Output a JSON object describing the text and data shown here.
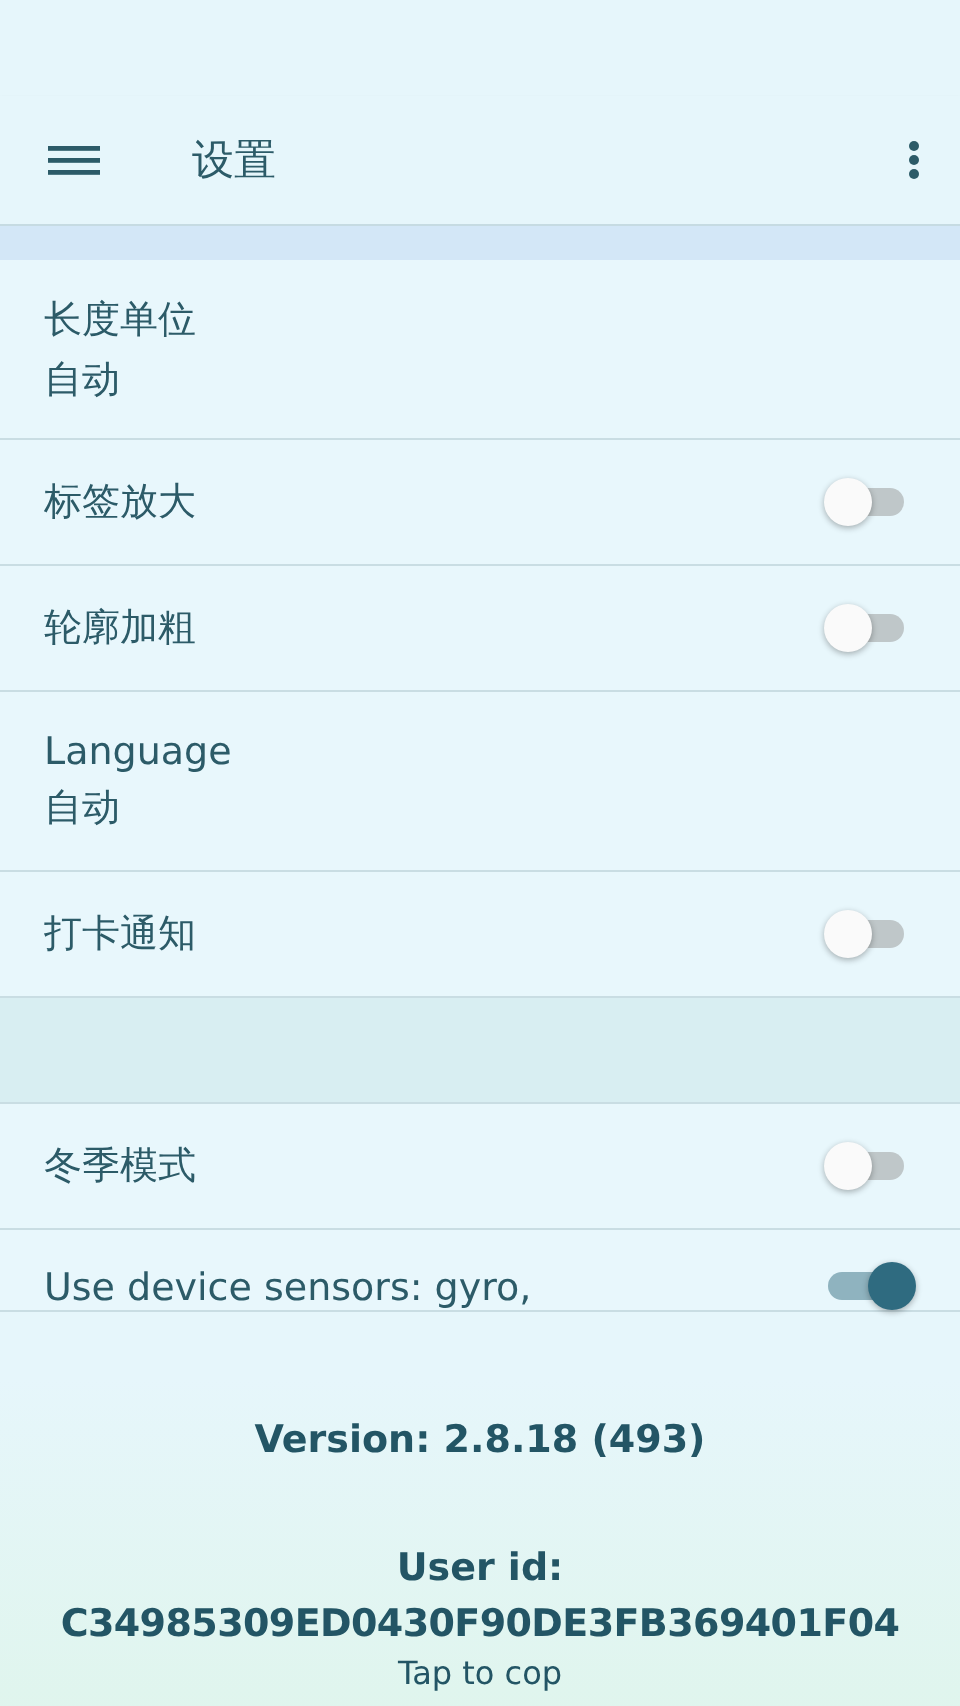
{
  "app_bar": {
    "title": "设置"
  },
  "sections": [
    {
      "items": [
        {
          "kind": "value",
          "label": "长度单位",
          "value": "自动"
        },
        {
          "kind": "switch",
          "label": "标签放大",
          "on": false
        },
        {
          "kind": "switch",
          "label": "轮廓加粗",
          "on": false
        },
        {
          "kind": "value",
          "label": "Language",
          "value": "自动"
        },
        {
          "kind": "switch",
          "label": "打卡通知",
          "on": false
        }
      ]
    },
    {
      "items": [
        {
          "kind": "switch",
          "label": "冬季模式",
          "on": false
        },
        {
          "kind": "switch",
          "label": "Use device sensors: gyro,",
          "on": true
        }
      ]
    }
  ],
  "footer": {
    "version": "Version: 2.8.18 (493)",
    "user_id_label": "User id:",
    "user_id": "C34985309ED0430F90DE3FB369401F04",
    "hint": "Tap to cop"
  }
}
